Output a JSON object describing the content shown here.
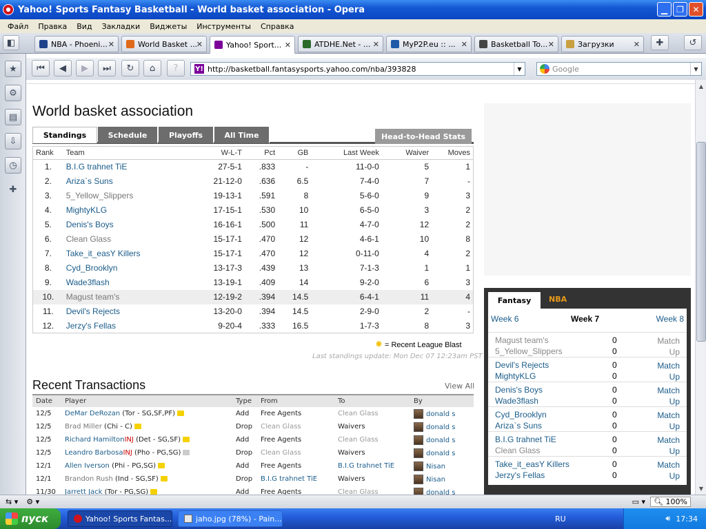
{
  "window": {
    "title": "Yahoo! Sports Fantasy Basketball - World basket association - Opera"
  },
  "menu": [
    "Файл",
    "Правка",
    "Вид",
    "Закладки",
    "Виджеты",
    "Инструменты",
    "Справка"
  ],
  "tabs": [
    {
      "label": "NBA - Phoeni...",
      "icon_color": "#1d428a"
    },
    {
      "label": "World Basket ...",
      "icon_color": "#e06a1b"
    },
    {
      "label": "Yahoo! Sport...",
      "icon_color": "#7b0099"
    },
    {
      "label": "ATDHE.Net - ...",
      "icon_color": "#2b6b2b"
    },
    {
      "label": "MyP2P.eu :: ...",
      "icon_color": "#1e5aa8"
    },
    {
      "label": "Basketball To...",
      "icon_color": "#444444"
    },
    {
      "label": "Загрузки",
      "icon_color": "#c8a040"
    }
  ],
  "address": {
    "url": "http://basketball.fantasysports.yahoo.com/nba/393828"
  },
  "search": {
    "placeholder": "Google"
  },
  "page": {
    "league_title": "World basket association",
    "tabs": [
      "Standings",
      "Schedule",
      "Playoffs",
      "All Time"
    ],
    "h2h_label": "Head-to-Head Stats",
    "standings_headers": [
      "Rank",
      "Team",
      "W-L-T",
      "Pct",
      "GB",
      "Last Week",
      "Waiver",
      "Moves"
    ],
    "standings": [
      {
        "rank": "1.",
        "team": "B.I.G trahnet TiE",
        "wlt": "27-5-1",
        "pct": ".833",
        "gb": "-",
        "last": "11-0-0",
        "waiver": "5",
        "moves": "1"
      },
      {
        "rank": "2.",
        "team": "Ariza`s Suns",
        "wlt": "21-12-0",
        "pct": ".636",
        "gb": "6.5",
        "last": "7-4-0",
        "waiver": "7",
        "moves": "-"
      },
      {
        "rank": "3.",
        "team": "5_Yellow_Slippers",
        "wlt": "19-13-1",
        "pct": ".591",
        "gb": "8",
        "last": "5-6-0",
        "waiver": "9",
        "moves": "3"
      },
      {
        "rank": "4.",
        "team": "MightyKLG",
        "wlt": "17-15-1",
        "pct": ".530",
        "gb": "10",
        "last": "6-5-0",
        "waiver": "3",
        "moves": "2"
      },
      {
        "rank": "5.",
        "team": "Denis's Boys",
        "wlt": "16-16-1",
        "pct": ".500",
        "gb": "11",
        "last": "4-7-0",
        "waiver": "12",
        "moves": "2"
      },
      {
        "rank": "6.",
        "team": "Clean Glass",
        "wlt": "15-17-1",
        "pct": ".470",
        "gb": "12",
        "last": "4-6-1",
        "waiver": "10",
        "moves": "8"
      },
      {
        "rank": "7.",
        "team": "Take_it_easY Killers",
        "wlt": "15-17-1",
        "pct": ".470",
        "gb": "12",
        "last": "0-11-0",
        "waiver": "4",
        "moves": "2"
      },
      {
        "rank": "8.",
        "team": "Cyd_Brooklyn",
        "wlt": "13-17-3",
        "pct": ".439",
        "gb": "13",
        "last": "7-1-3",
        "waiver": "1",
        "moves": "1"
      },
      {
        "rank": "9.",
        "team": "Wade3flash",
        "wlt": "13-19-1",
        "pct": ".409",
        "gb": "14",
        "last": "9-2-0",
        "waiver": "6",
        "moves": "3"
      },
      {
        "rank": "10.",
        "team": "Magust team's",
        "wlt": "12-19-2",
        "pct": ".394",
        "gb": "14.5",
        "last": "6-4-1",
        "waiver": "11",
        "moves": "4"
      },
      {
        "rank": "11.",
        "team": "Devil's Rejects",
        "wlt": "13-20-0",
        "pct": ".394",
        "gb": "14.5",
        "last": "2-9-0",
        "waiver": "2",
        "moves": "-"
      },
      {
        "rank": "12.",
        "team": "Jerzy's Fellas",
        "wlt": "9-20-4",
        "pct": ".333",
        "gb": "16.5",
        "last": "1-7-3",
        "waiver": "8",
        "moves": "3"
      }
    ],
    "blast_label": "= Recent League Blast",
    "last_update": "Last standings update: Mon Dec 07 12:23am PST",
    "transactions_title": "Recent Transactions",
    "view_all": "View All",
    "transactions_headers": [
      "Date",
      "Player",
      "Type",
      "From",
      "To",
      "By"
    ],
    "transactions": [
      {
        "date": "12/5",
        "player": "DeMar DeRozan",
        "inj": "",
        "info": "(Tor - SG,SF,PF)",
        "type": "Add",
        "from": "Free Agents",
        "to": "Clean Glass",
        "by": "donald s"
      },
      {
        "date": "12/5",
        "player": "Brad Miller",
        "inj": "",
        "info": "(Chi - C)",
        "type": "Drop",
        "from": "Clean Glass",
        "to": "Waivers",
        "by": "donald s"
      },
      {
        "date": "12/5",
        "player": "Richard Hamilton",
        "inj": "INJ",
        "info": "(Det - SG,SF)",
        "type": "Add",
        "from": "Free Agents",
        "to": "Clean Glass",
        "by": "donald s"
      },
      {
        "date": "12/5",
        "player": "Leandro Barbosa",
        "inj": "INJ",
        "info": "(Pho - PG,SG)",
        "type": "Drop",
        "from": "Clean Glass",
        "to": "Waivers",
        "by": "donald s"
      },
      {
        "date": "12/1",
        "player": "Allen Iverson",
        "inj": "",
        "info": "(Phi - PG,SG)",
        "type": "Add",
        "from": "Free Agents",
        "to": "B.I.G trahnet TiE",
        "by": "Nisan"
      },
      {
        "date": "12/1",
        "player": "Brandon Rush",
        "inj": "",
        "info": "(Ind - SG,SF)",
        "type": "Drop",
        "from": "B.I.G trahnet TiE",
        "to": "Waivers",
        "by": "Nisan"
      },
      {
        "date": "11/30",
        "player": "Jarrett Jack",
        "inj": "",
        "info": "(Tor - PG,SG)",
        "type": "Add",
        "from": "Free Agents",
        "to": "Clean Glass",
        "by": "donald s"
      }
    ],
    "matchups": {
      "tab_fantasy": "Fantasy",
      "tab_nba": "NBA",
      "prev_week": "Week 6",
      "current_week": "Week 7",
      "next_week": "Week 8",
      "match_word": "Match",
      "up_word": "Up",
      "rows": [
        {
          "team1": "Magust team's",
          "score1": "0",
          "team2": "5_Yellow_Slippers",
          "score2": "0"
        },
        {
          "team1": "Devil's Rejects",
          "score1": "0",
          "team2": "MightyKLG",
          "score2": "0"
        },
        {
          "team1": "Denis's Boys",
          "score1": "0",
          "team2": "Wade3flash",
          "score2": "0"
        },
        {
          "team1": "Cyd_Brooklyn",
          "score1": "0",
          "team2": "Ariza`s Suns",
          "score2": "0"
        },
        {
          "team1": "B.I.G trahnet TiE",
          "score1": "0",
          "team2": "Clean Glass",
          "score2": "0"
        },
        {
          "team1": "Take_it_easY Killers",
          "score1": "0",
          "team2": "Jerzy's Fellas",
          "score2": "0"
        }
      ]
    }
  },
  "status": {
    "zoom": "100%"
  },
  "taskbar": {
    "start": "пуск",
    "items": [
      "Yahoo! Sports Fantas...",
      "jaho.jpg (78%) - Pain..."
    ],
    "lang": "RU",
    "time": "17:34"
  }
}
